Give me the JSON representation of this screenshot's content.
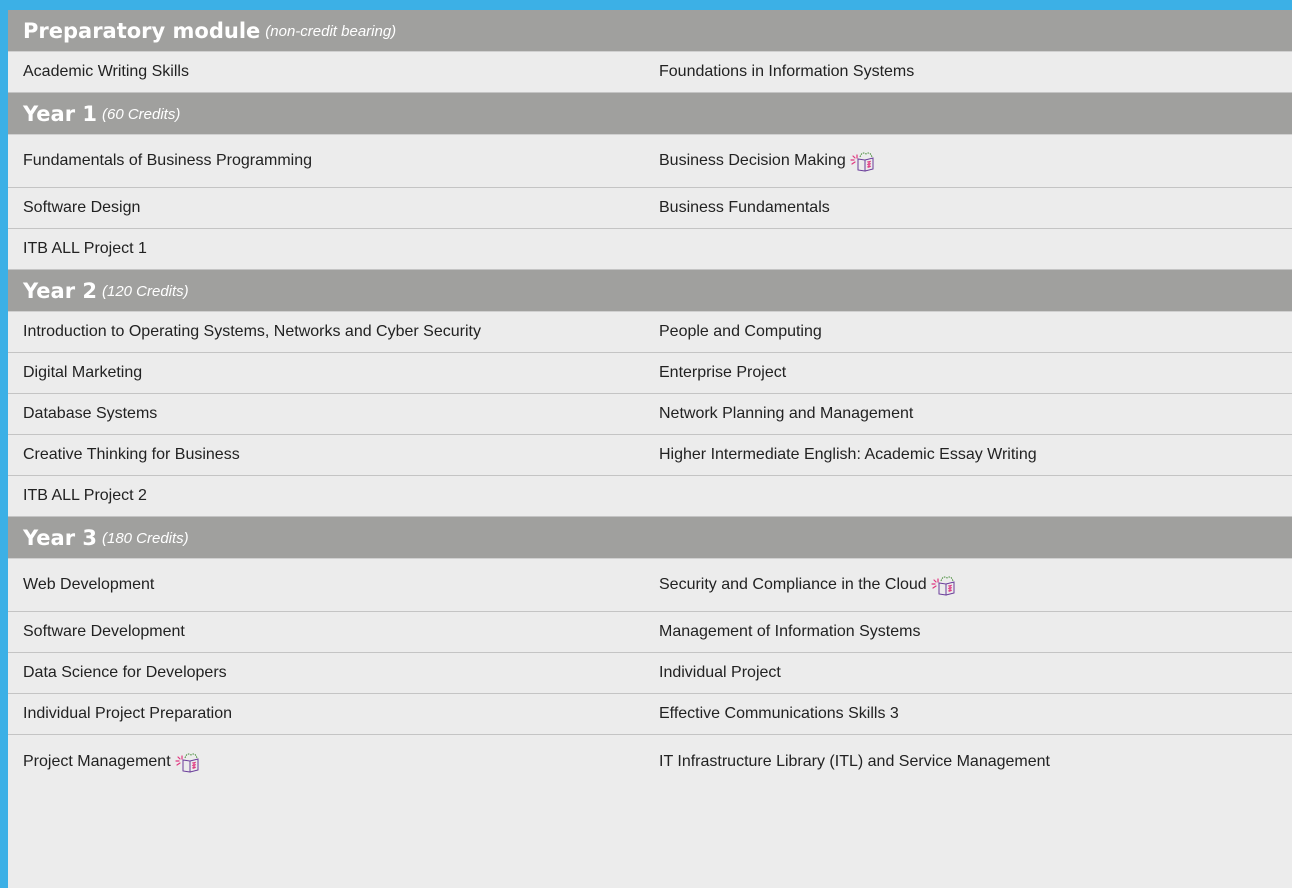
{
  "sections": [
    {
      "title": "Preparatory module",
      "note": "(non-credit bearing)",
      "rows": [
        [
          "Academic Writing Skills",
          "Foundations in Information Systems"
        ]
      ]
    },
    {
      "title": "Year 1",
      "note": "(60 Credits)",
      "rows": [
        [
          "Fundamentals of Business Programming",
          "Business Decision Making"
        ],
        [
          "Software Design",
          "Business Fundamentals"
        ],
        [
          "ITB ALL Project 1",
          ""
        ]
      ]
    },
    {
      "title": "Year 2",
      "note": "(120 Credits)",
      "rows": [
        [
          "Introduction to Operating Systems, Networks and Cyber Security",
          "People and Computing"
        ],
        [
          "Digital Marketing",
          "Enterprise Project"
        ],
        [
          "Database Systems",
          "Network Planning and Management"
        ],
        [
          "Creative Thinking for Business",
          "Higher Intermediate English: Academic Essay Writing"
        ],
        [
          "ITB ALL Project 2",
          ""
        ]
      ]
    },
    {
      "title": "Year 3",
      "note": "(180 Credits)",
      "rows": [
        [
          "Web Development",
          "Security and Compliance in the Cloud"
        ],
        [
          "Software Development",
          "Management of Information Systems"
        ],
        [
          "Data Science for Developers",
          "Individual Project"
        ],
        [
          "Individual Project Preparation",
          "Effective Communications Skills 3"
        ],
        [
          "Project Management",
          "IT Infrastructure Library (ITL) and Service Management"
        ]
      ]
    }
  ],
  "icon_name": "online-learning-icon",
  "colors": {
    "frame": "#3cb0e6",
    "header_bg": "#a0a09e",
    "row_bg": "#ececec",
    "icon_accent": "#e0367f"
  }
}
